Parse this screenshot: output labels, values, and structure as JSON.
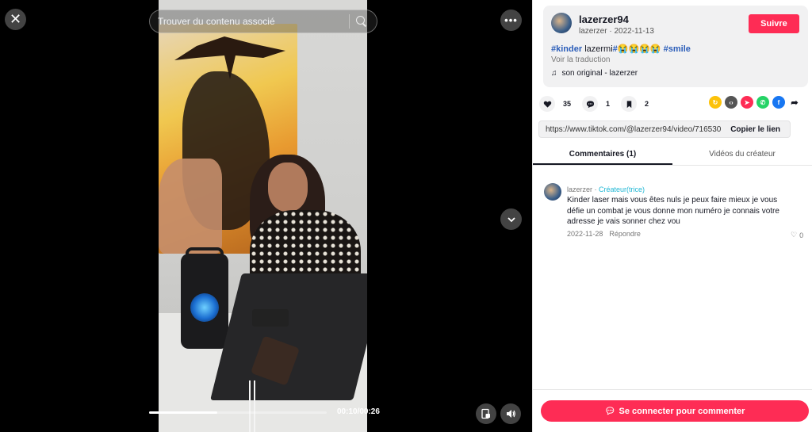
{
  "search": {
    "placeholder": "Trouver du contenu associé"
  },
  "player": {
    "time": "00:10/00:26",
    "progress_fraction": 0.385
  },
  "icons": {
    "close": "close-icon",
    "search": "search-icon",
    "more": "more-icon",
    "down": "chevron-down-icon",
    "pip": "picture-in-picture-icon",
    "volume": "volume-icon"
  },
  "author": {
    "username": "lazerzer94",
    "nickname": "lazerzer",
    "date": "2022-11-13",
    "follow_label": "Suivre"
  },
  "caption": {
    "tag1": "#kinder",
    "middle": " lazermi",
    "tag2": "#",
    "emojis": "😭😭😭😭",
    "tag3": " #smile",
    "translate": "Voir la traduction",
    "music": "son original - lazerzer"
  },
  "actions": {
    "likes": "35",
    "comments": "1",
    "bookmarks": "2"
  },
  "share": [
    "embed-icon",
    "send-icon",
    "whatsapp-icon",
    "facebook-icon",
    "share-arrow-icon"
  ],
  "link": {
    "url": "https://www.tiktok.com/@lazerzer94/video/716530...",
    "copy_label": "Copier le lien"
  },
  "tabs": [
    {
      "label": "Commentaires (1)"
    },
    {
      "label": "Vidéos du créateur"
    }
  ],
  "comment": {
    "user": "lazerzer",
    "dot": " · ",
    "badge": "Créateur(trice)",
    "text": "Kinder laser mais vous êtes nuls je peux faire mieux je vous défie un combat je vous donne mon numéro je connais votre adresse je vais sonner chez vou",
    "date": "2022-11-28",
    "reply_label": "Répondre",
    "likes": "0"
  },
  "login": {
    "label": "Se connecter pour commenter"
  },
  "colors": {
    "brand": "#fe2c55",
    "tag": "#2b5db9",
    "creator": "#20b7d4"
  }
}
